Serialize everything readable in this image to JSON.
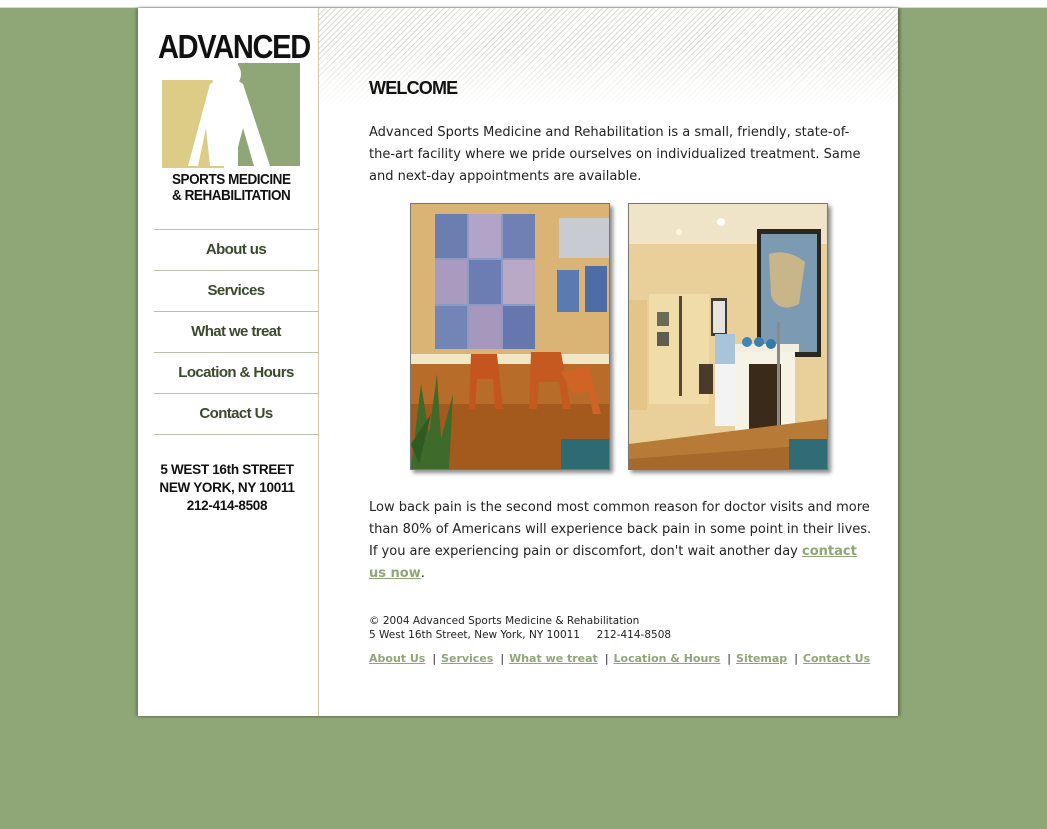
{
  "sidebar": {
    "logo": {
      "word": "ADVANCED",
      "line1": "SPORTS MEDICINE",
      "line2": "& REHABILITATION",
      "colors": {
        "tan": "#dccc85",
        "green": "#8fa776",
        "black": "#111111"
      }
    },
    "nav": [
      {
        "label": "About us"
      },
      {
        "label": "Services"
      },
      {
        "label": "What we treat"
      },
      {
        "label": "Location & Hours"
      },
      {
        "label": "Contact Us"
      }
    ],
    "address": {
      "street": "5 WEST 16th STREET",
      "city": "NEW YORK, NY 10011",
      "phone": "212-414-8508"
    }
  },
  "main": {
    "heading": "WELCOME",
    "intro": "Advanced Sports Medicine and Rehabilitation is a small, friendly, state-of-the-art facility where we pride ourselves on individualized treatment. Same and next-day appointments are available.",
    "photos": [
      {
        "icon": "waiting-room-photo"
      },
      {
        "icon": "office-hallway-photo"
      }
    ],
    "body_text": "Low back pain is the second most common reason for doctor visits and more than 80% of Americans will experience back pain in some point in their lives. If you are experiencing pain or discomfort, don't wait another day ",
    "cta_link": "contact us now",
    "cta_tail": "."
  },
  "footer": {
    "copyright": "© 2004 Advanced Sports Medicine & Rehabilitation",
    "address_line": "5 West 16th Street, New York, NY 10011     212-414-8508",
    "links": [
      "About Us",
      "Services",
      "What we treat",
      "Location & Hours",
      "Sitemap",
      "Contact Us"
    ],
    "separator": "|"
  },
  "colors": {
    "background": "#8fa776",
    "link": "#8fa776",
    "nav_text": "#3b4a2c"
  }
}
